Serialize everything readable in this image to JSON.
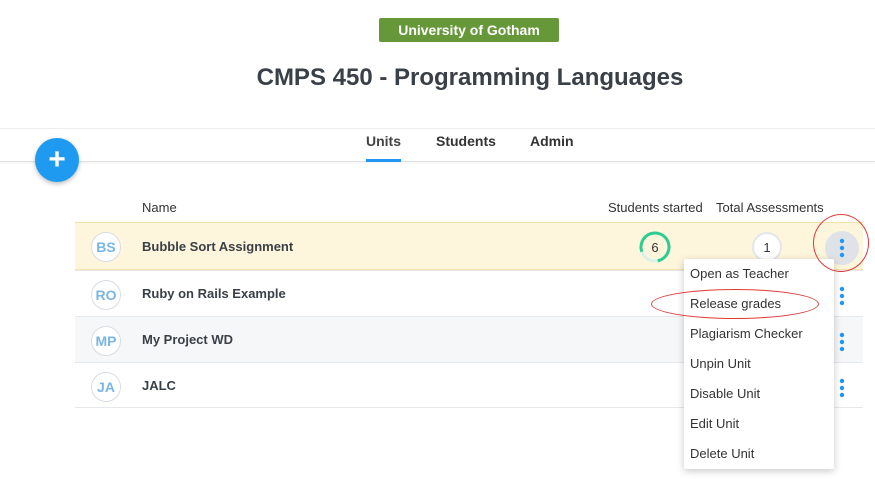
{
  "header": {
    "org_name": "University of Gotham",
    "course_title": "CMPS 450 - Programming Languages"
  },
  "tabs": [
    {
      "label": "Units",
      "active": true
    },
    {
      "label": "Students",
      "active": false
    },
    {
      "label": "Admin",
      "active": false
    }
  ],
  "add_button": {
    "icon": "plus-icon",
    "label": "+"
  },
  "table": {
    "columns": {
      "name": "Name",
      "students_started": "Students started",
      "total_assessments": "Total Assessments"
    },
    "rows": [
      {
        "initials": "BS",
        "name": "Bubble Sort Assignment",
        "students_started": "6",
        "total_assessments": "1"
      },
      {
        "initials": "RO",
        "name": "Ruby on Rails Example"
      },
      {
        "initials": "MP",
        "name": "My Project WD"
      },
      {
        "initials": "JA",
        "name": "JALC"
      }
    ]
  },
  "context_menu": {
    "items": [
      "Open as Teacher",
      "Release grades",
      "Plagiarism Checker",
      "Unpin Unit",
      "Disable Unit",
      "Edit Unit",
      "Delete Unit"
    ]
  },
  "colors": {
    "accent": "#2196f3",
    "org_badge": "#66983a",
    "highlight_row": "#fdf6dc",
    "progress_ring": "#2ecc8f",
    "annotation": "#e03a3a"
  }
}
